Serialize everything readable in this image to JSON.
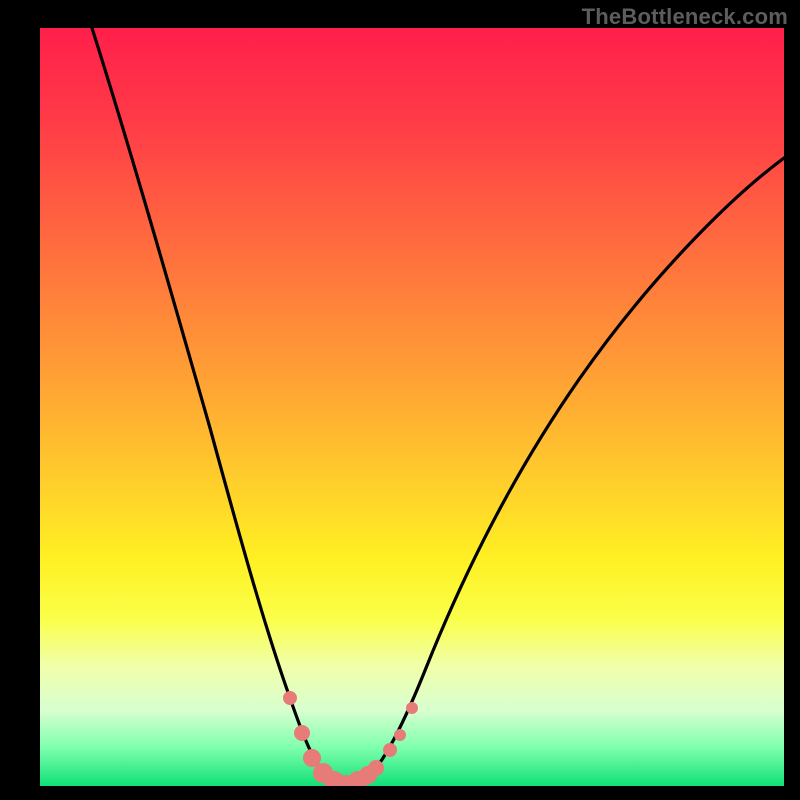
{
  "watermark": "TheBottleneck.com",
  "colors": {
    "frame": "#000000",
    "curve": "#000000",
    "marker": "#e77b78",
    "gradient_top": "#ff1f4b",
    "gradient_bottom": "#10e077"
  },
  "chart_data": {
    "type": "line",
    "title": "",
    "xlabel": "",
    "ylabel": "",
    "xlim": [
      0,
      100
    ],
    "ylim": [
      0,
      100
    ],
    "grid": false,
    "legend": false,
    "note": "Axes have no visible tick labels; values are inferred as 0–100 percentage ranges along width and height.",
    "series": [
      {
        "name": "bottleneck-curve",
        "x": [
          7,
          10,
          14,
          18,
          22,
          26,
          28,
          30,
          32,
          34,
          36,
          38,
          39.5,
          41,
          43,
          45,
          48,
          52,
          56,
          62,
          70,
          80,
          90,
          100
        ],
        "y": [
          100,
          88,
          74,
          60,
          46,
          32,
          24,
          16,
          9,
          4,
          1,
          0,
          0,
          0,
          1,
          3,
          7,
          13,
          21,
          31,
          43,
          55,
          64,
          70
        ]
      }
    ],
    "markers": {
      "name": "highlighted-points",
      "x": [
        30,
        32,
        34,
        36,
        38,
        39.5,
        41,
        43,
        45,
        46,
        48
      ],
      "y": [
        16,
        9,
        4,
        1,
        0,
        0,
        0,
        1,
        3,
        4,
        7
      ],
      "size_hint": "larger near trough, smaller on edges"
    }
  }
}
